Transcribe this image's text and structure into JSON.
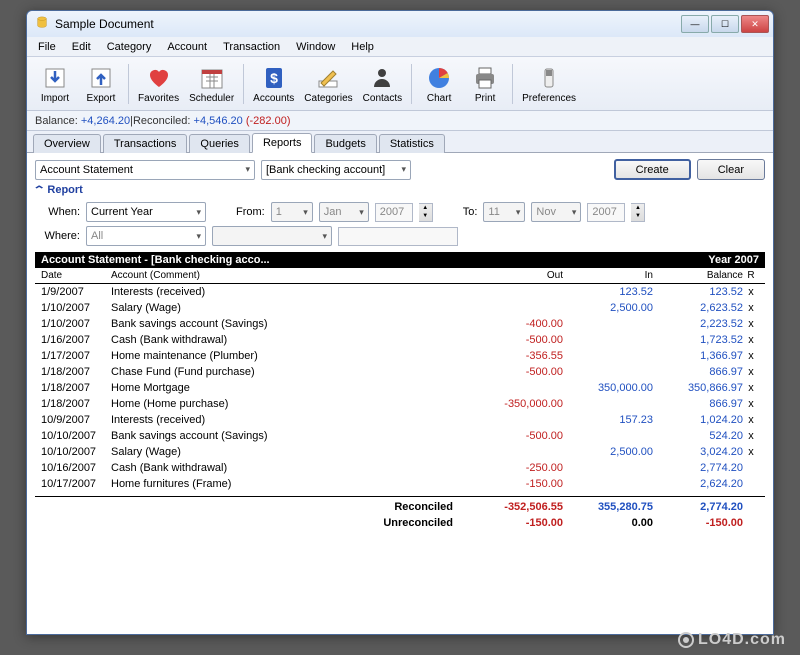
{
  "window": {
    "title": "Sample Document"
  },
  "menubar": [
    "File",
    "Edit",
    "Category",
    "Account",
    "Transaction",
    "Window",
    "Help"
  ],
  "toolbar": [
    {
      "label": "Import",
      "icon": "import"
    },
    {
      "label": "Export",
      "icon": "export"
    },
    {
      "sep": true
    },
    {
      "label": "Favorites",
      "icon": "heart"
    },
    {
      "label": "Scheduler",
      "icon": "calendar"
    },
    {
      "sep": true
    },
    {
      "label": "Accounts",
      "icon": "dollar"
    },
    {
      "label": "Categories",
      "icon": "pencil"
    },
    {
      "label": "Contacts",
      "icon": "person"
    },
    {
      "sep": true
    },
    {
      "label": "Chart",
      "icon": "pie"
    },
    {
      "label": "Print",
      "icon": "printer"
    },
    {
      "sep": true
    },
    {
      "label": "Preferences",
      "icon": "switch"
    }
  ],
  "balance": {
    "label_balance": "Balance:",
    "balance_val": "+4,264.20",
    "sep": " | ",
    "label_rec": "Reconciled:",
    "rec_val": "+4,546.20",
    "diff": "(-282.00)"
  },
  "tabs": [
    "Overview",
    "Transactions",
    "Queries",
    "Reports",
    "Budgets",
    "Statistics"
  ],
  "active_tab": 3,
  "filters": {
    "report_type": "Account Statement",
    "account": "[Bank checking account]",
    "create": "Create",
    "clear": "Clear",
    "section": "Report",
    "when_label": "When:",
    "when_value": "Current Year",
    "from_label": "From:",
    "from_day": "1",
    "from_month": "Jan",
    "from_year": "2007",
    "to_label": "To:",
    "to_day": "11",
    "to_month": "Nov",
    "to_year": "2007",
    "where_label": "Where:",
    "where_value": "All"
  },
  "report": {
    "banner_title": "Account Statement - [Bank checking acco...",
    "banner_year": "Year 2007",
    "cols": {
      "date": "Date",
      "account": "Account (Comment)",
      "out": "Out",
      "in": "In",
      "balance": "Balance",
      "r": "R"
    },
    "rows": [
      {
        "date": "1/9/2007",
        "account": "Interests (received)",
        "out": "",
        "in": "123.52",
        "bal": "123.52",
        "r": "x"
      },
      {
        "date": "1/10/2007",
        "account": "Salary (Wage)",
        "out": "",
        "in": "2,500.00",
        "bal": "2,623.52",
        "r": "x"
      },
      {
        "date": "1/10/2007",
        "account": "Bank savings account (Savings)",
        "out": "-400.00",
        "in": "",
        "bal": "2,223.52",
        "r": "x"
      },
      {
        "date": "1/16/2007",
        "account": "Cash (Bank withdrawal)",
        "out": "-500.00",
        "in": "",
        "bal": "1,723.52",
        "r": "x"
      },
      {
        "date": "1/17/2007",
        "account": "Home maintenance (Plumber)",
        "out": "-356.55",
        "in": "",
        "bal": "1,366.97",
        "r": "x"
      },
      {
        "date": "1/18/2007",
        "account": "Chase Fund (Fund purchase)",
        "out": "-500.00",
        "in": "",
        "bal": "866.97",
        "r": "x"
      },
      {
        "date": "1/18/2007",
        "account": "Home Mortgage",
        "out": "",
        "in": "350,000.00",
        "bal": "350,866.97",
        "r": "x"
      },
      {
        "date": "1/18/2007",
        "account": "Home (Home purchase)",
        "out": "-350,000.00",
        "in": "",
        "bal": "866.97",
        "r": "x"
      },
      {
        "date": "10/9/2007",
        "account": "Interests (received)",
        "out": "",
        "in": "157.23",
        "bal": "1,024.20",
        "r": "x"
      },
      {
        "date": "10/10/2007",
        "account": "Bank savings account (Savings)",
        "out": "-500.00",
        "in": "",
        "bal": "524.20",
        "r": "x"
      },
      {
        "date": "10/10/2007",
        "account": "Salary (Wage)",
        "out": "",
        "in": "2,500.00",
        "bal": "3,024.20",
        "r": "x"
      },
      {
        "date": "10/16/2007",
        "account": "Cash (Bank withdrawal)",
        "out": "-250.00",
        "in": "",
        "bal": "2,774.20",
        "r": ""
      },
      {
        "date": "10/17/2007",
        "account": "Home furnitures (Frame)",
        "out": "-150.00",
        "in": "",
        "bal": "2,624.20",
        "r": ""
      }
    ],
    "summary": [
      {
        "label": "Reconciled",
        "out": "-352,506.55",
        "in": "355,280.75",
        "bal": "2,774.20"
      },
      {
        "label": "Unreconciled",
        "out": "-150.00",
        "in": "0.00",
        "bal": "-150.00"
      }
    ]
  },
  "watermark": "LO4D.com"
}
